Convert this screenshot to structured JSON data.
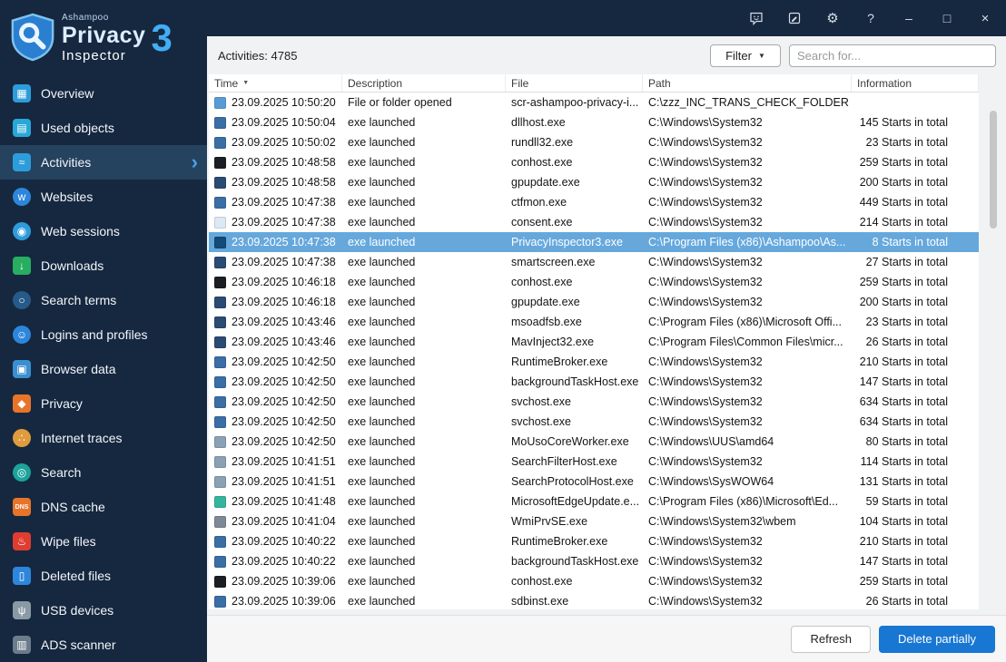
{
  "titlebar": {
    "settings_glyph": "⚙",
    "help_glyph": "?",
    "minimize_glyph": "–",
    "maximize_glyph": "□",
    "close_glyph": "×"
  },
  "logo": {
    "brand": "Ashampoo",
    "product_line1": "Privacy",
    "product_line2": "Inspector",
    "version": "3"
  },
  "sidebar": {
    "items": [
      {
        "label": "Overview",
        "icon": "overview-icon",
        "glyph": "▦",
        "color": "#2d9cdb",
        "shape": "square",
        "selected": false
      },
      {
        "label": "Used objects",
        "icon": "used-objects-icon",
        "glyph": "▤",
        "color": "#29a8d8",
        "shape": "square",
        "selected": false
      },
      {
        "label": "Activities",
        "icon": "activities-icon",
        "glyph": "≈",
        "color": "#2d9cdb",
        "shape": "square",
        "selected": true
      },
      {
        "label": "Websites",
        "icon": "websites-icon",
        "glyph": "w",
        "color": "#2d86db",
        "shape": "round",
        "selected": false
      },
      {
        "label": "Web sessions",
        "icon": "web-sessions-icon",
        "glyph": "◉",
        "color": "#2d9cdb",
        "shape": "round",
        "selected": false
      },
      {
        "label": "Downloads",
        "icon": "downloads-icon",
        "glyph": "↓",
        "color": "#27ae60",
        "shape": "square",
        "selected": false
      },
      {
        "label": "Search terms",
        "icon": "search-terms-icon",
        "glyph": "○",
        "color": "#265a88",
        "shape": "round",
        "selected": false
      },
      {
        "label": "Logins and profiles",
        "icon": "logins-profiles-icon",
        "glyph": "☺",
        "color": "#2d86db",
        "shape": "round",
        "selected": false
      },
      {
        "label": "Browser data",
        "icon": "browser-data-icon",
        "glyph": "▣",
        "color": "#3a8fd0",
        "shape": "square",
        "selected": false
      },
      {
        "label": "Privacy",
        "icon": "privacy-shield-icon",
        "glyph": "◆",
        "color": "#e8742a",
        "shape": "square",
        "selected": false
      },
      {
        "label": "Internet traces",
        "icon": "internet-traces-icon",
        "glyph": "∴",
        "color": "#e09c3c",
        "shape": "round",
        "selected": false
      },
      {
        "label": "Search",
        "icon": "search-globe-icon",
        "glyph": "◎",
        "color": "#1ba39c",
        "shape": "round",
        "selected": false
      },
      {
        "label": "DNS cache",
        "icon": "dns-cache-icon",
        "glyph": "DNS",
        "color": "#e8742a",
        "shape": "square",
        "small": true,
        "selected": false
      },
      {
        "label": "Wipe files",
        "icon": "wipe-files-icon",
        "glyph": "♨",
        "color": "#e03c31",
        "shape": "square",
        "selected": false
      },
      {
        "label": "Deleted files",
        "icon": "deleted-files-icon",
        "glyph": "▯",
        "color": "#2d86db",
        "shape": "square",
        "selected": false
      },
      {
        "label": "USB devices",
        "icon": "usb-devices-icon",
        "glyph": "ψ",
        "color": "#8a9aa5",
        "shape": "square",
        "selected": false
      },
      {
        "label": "ADS scanner",
        "icon": "ads-scanner-icon",
        "glyph": "▥",
        "color": "#6b7c8a",
        "shape": "square",
        "selected": false
      }
    ],
    "selected_chevron": "›"
  },
  "header": {
    "activities_count": "Activities: 4785",
    "filter_label": "Filter",
    "filter_caret": "▼",
    "search_placeholder": "Search for..."
  },
  "table": {
    "columns": [
      "Time",
      "Description",
      "File",
      "Path",
      "Information"
    ],
    "sort_icon": "▼",
    "rows": [
      {
        "time": "23.09.2025 10:50:20",
        "description": "File or folder opened",
        "file": "scr-ashampoo-privacy-i...",
        "path": "C:\\zzz_INC_TRANS_CHECK_FOLDER",
        "info": "",
        "icon_color": "#5b9bd5",
        "selected": false
      },
      {
        "time": "23.09.2025 10:50:04",
        "description": "exe launched",
        "file": "dllhost.exe",
        "path": "C:\\Windows\\System32",
        "info": "145 Starts in total",
        "icon_color": "#3a6ea5",
        "selected": false
      },
      {
        "time": "23.09.2025 10:50:02",
        "description": "exe launched",
        "file": "rundll32.exe",
        "path": "C:\\Windows\\System32",
        "info": "23 Starts in total",
        "icon_color": "#3a6ea5",
        "selected": false
      },
      {
        "time": "23.09.2025 10:48:58",
        "description": "exe launched",
        "file": "conhost.exe",
        "path": "C:\\Windows\\System32",
        "info": "259 Starts in total",
        "icon_color": "#1b1e23",
        "selected": false
      },
      {
        "time": "23.09.2025 10:48:58",
        "description": "exe launched",
        "file": "gpupdate.exe",
        "path": "C:\\Windows\\System32",
        "info": "200 Starts in total",
        "icon_color": "#2b4b73",
        "selected": false
      },
      {
        "time": "23.09.2025 10:47:38",
        "description": "exe launched",
        "file": "ctfmon.exe",
        "path": "C:\\Windows\\System32",
        "info": "449 Starts in total",
        "icon_color": "#3a6ea5",
        "selected": false
      },
      {
        "time": "23.09.2025 10:47:38",
        "description": "exe launched",
        "file": "consent.exe",
        "path": "C:\\Windows\\System32",
        "info": "214 Starts in total",
        "icon_color": "#dce8f4",
        "selected": false
      },
      {
        "time": "23.09.2025 10:47:38",
        "description": "exe launched",
        "file": "PrivacyInspector3.exe",
        "path": "C:\\Program Files (x86)\\Ashampoo\\As...",
        "info": "8 Starts in total",
        "icon_color": "#144a77",
        "selected": true
      },
      {
        "time": "23.09.2025 10:47:38",
        "description": "exe launched",
        "file": "smartscreen.exe",
        "path": "C:\\Windows\\System32",
        "info": "27 Starts in total",
        "icon_color": "#2b4b73",
        "selected": false
      },
      {
        "time": "23.09.2025 10:46:18",
        "description": "exe launched",
        "file": "conhost.exe",
        "path": "C:\\Windows\\System32",
        "info": "259 Starts in total",
        "icon_color": "#1b1e23",
        "selected": false
      },
      {
        "time": "23.09.2025 10:46:18",
        "description": "exe launched",
        "file": "gpupdate.exe",
        "path": "C:\\Windows\\System32",
        "info": "200 Starts in total",
        "icon_color": "#2b4b73",
        "selected": false
      },
      {
        "time": "23.09.2025 10:43:46",
        "description": "exe launched",
        "file": "msoadfsb.exe",
        "path": "C:\\Program Files (x86)\\Microsoft Offi...",
        "info": "23 Starts in total",
        "icon_color": "#2b4b73",
        "selected": false
      },
      {
        "time": "23.09.2025 10:43:46",
        "description": "exe launched",
        "file": "MavInject32.exe",
        "path": "C:\\Program Files\\Common Files\\micr...",
        "info": "26 Starts in total",
        "icon_color": "#2b4b73",
        "selected": false
      },
      {
        "time": "23.09.2025 10:42:50",
        "description": "exe launched",
        "file": "RuntimeBroker.exe",
        "path": "C:\\Windows\\System32",
        "info": "210 Starts in total",
        "icon_color": "#3a6ea5",
        "selected": false
      },
      {
        "time": "23.09.2025 10:42:50",
        "description": "exe launched",
        "file": "backgroundTaskHost.exe",
        "path": "C:\\Windows\\System32",
        "info": "147 Starts in total",
        "icon_color": "#3a6ea5",
        "selected": false
      },
      {
        "time": "23.09.2025 10:42:50",
        "description": "exe launched",
        "file": "svchost.exe",
        "path": "C:\\Windows\\System32",
        "info": "634 Starts in total",
        "icon_color": "#3a6ea5",
        "selected": false
      },
      {
        "time": "23.09.2025 10:42:50",
        "description": "exe launched",
        "file": "svchost.exe",
        "path": "C:\\Windows\\System32",
        "info": "634 Starts in total",
        "icon_color": "#3a6ea5",
        "selected": false
      },
      {
        "time": "23.09.2025 10:42:50",
        "description": "exe launched",
        "file": "MoUsoCoreWorker.exe",
        "path": "C:\\Windows\\UUS\\amd64",
        "info": "80 Starts in total",
        "icon_color": "#8aa0b4",
        "selected": false
      },
      {
        "time": "23.09.2025 10:41:51",
        "description": "exe launched",
        "file": "SearchFilterHost.exe",
        "path": "C:\\Windows\\System32",
        "info": "114 Starts in total",
        "icon_color": "#8aa0b4",
        "selected": false
      },
      {
        "time": "23.09.2025 10:41:51",
        "description": "exe launched",
        "file": "SearchProtocolHost.exe",
        "path": "C:\\Windows\\SysWOW64",
        "info": "131 Starts in total",
        "icon_color": "#8aa0b4",
        "selected": false
      },
      {
        "time": "23.09.2025 10:41:48",
        "description": "exe launched",
        "file": "MicrosoftEdgeUpdate.e...",
        "path": "C:\\Program Files (x86)\\Microsoft\\Ed...",
        "info": "59 Starts in total",
        "icon_color": "#35b5a0",
        "selected": false
      },
      {
        "time": "23.09.2025 10:41:04",
        "description": "exe launched",
        "file": "WmiPrvSE.exe",
        "path": "C:\\Windows\\System32\\wbem",
        "info": "104 Starts in total",
        "icon_color": "#7d8a96",
        "selected": false
      },
      {
        "time": "23.09.2025 10:40:22",
        "description": "exe launched",
        "file": "RuntimeBroker.exe",
        "path": "C:\\Windows\\System32",
        "info": "210 Starts in total",
        "icon_color": "#3a6ea5",
        "selected": false
      },
      {
        "time": "23.09.2025 10:40:22",
        "description": "exe launched",
        "file": "backgroundTaskHost.exe",
        "path": "C:\\Windows\\System32",
        "info": "147 Starts in total",
        "icon_color": "#3a6ea5",
        "selected": false
      },
      {
        "time": "23.09.2025 10:39:06",
        "description": "exe launched",
        "file": "conhost.exe",
        "path": "C:\\Windows\\System32",
        "info": "259 Starts in total",
        "icon_color": "#1b1e23",
        "selected": false
      },
      {
        "time": "23.09.2025 10:39:06",
        "description": "exe launched",
        "file": "sdbinst.exe",
        "path": "C:\\Windows\\System32",
        "info": "26 Starts in total",
        "icon_color": "#3a6ea5",
        "selected": false
      }
    ]
  },
  "footer": {
    "refresh_label": "Refresh",
    "delete_label": "Delete partially"
  },
  "colors": {
    "accent_blue": "#1877d2",
    "selected_row": "#66a8dc",
    "sidebar_bg": "#16283f"
  }
}
